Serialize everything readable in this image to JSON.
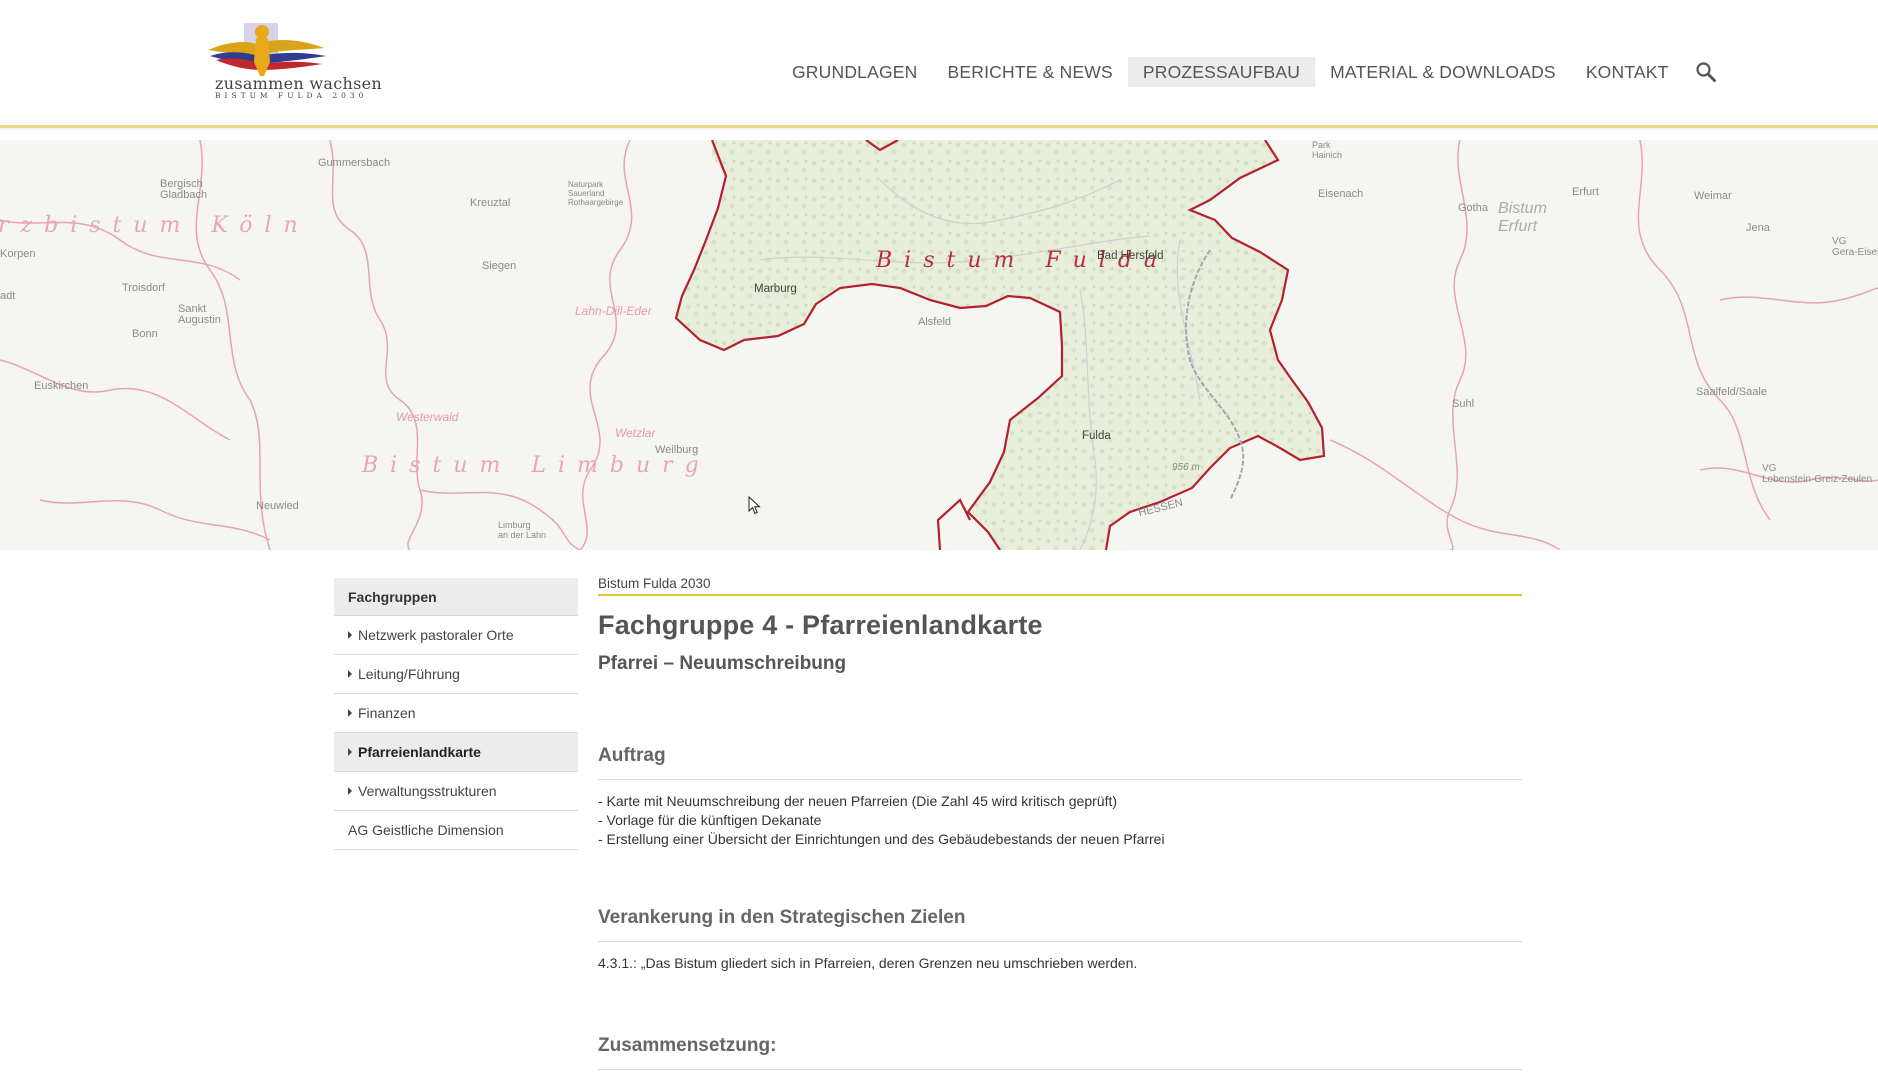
{
  "logo": {
    "text": "zusammen wachsen",
    "subtext": "BISTUM FULDA 2030"
  },
  "nav": {
    "items": [
      "GRUNDLAGEN",
      "BERICHTE & NEWS",
      "PROZESSAUFBAU",
      "MATERIAL & DOWNLOADS",
      "KONTAKT"
    ],
    "active": "PROZESSAUFBAU",
    "search_icon": "search-icon"
  },
  "map": {
    "dioceses": [
      "Bistum Köln",
      "Bistum Fulda",
      "Bistum Limburg",
      "Bistum Erfurt"
    ],
    "labels": {
      "bistum_koln": "rzbistum Köln",
      "bistum_fulda": "Bistum Fulda",
      "bistum_limburg": "Bistum Limburg",
      "bistum_erfurt": "Bistum\nErfurt",
      "marburg": "Marburg",
      "bad_hersfeld": "Bad Hersfeld",
      "fulda": "Fulda",
      "alsfeld": "Alsfeld",
      "gummersbach": "Gummersbach",
      "bergisch_gladbach": "Bergisch\nGladbach",
      "kreuztal": "Kreuztal",
      "siegen": "Siegen",
      "naturpark": "Naturpark\nSauerland\nRothaargebirge",
      "lahn_dill": "Lahn-Dill-Eder",
      "troisdorf": "Troisdorf",
      "sankt_augustin": "Sankt\nAugustin",
      "bonn": "Bonn",
      "euskirchen": "Euskirchen",
      "westerwald": "Westerwald",
      "wetzlar": "Wetzlar",
      "weilburg": "Weilburg",
      "neuwied": "Neuwied",
      "limburg_lahn": "Limburg\nan der Lahn",
      "eisenach": "Eisenach",
      "gotha": "Gotha",
      "erfurt": "Erfurt",
      "weimar": "Weimar",
      "jena": "Jena",
      "vg_gera": "VG\nGera-Eisenb",
      "suhl": "Suhl",
      "saalfeld": "Saalfeld/Saale",
      "vg_lobenstein": "VG\nLobenstein-Greiz-Zeulen",
      "hessen": "HESSEN",
      "elevation": "956 m",
      "korpen": "Korpen",
      "bad_hersfeld_park": "Park\nHainich",
      "duren": "adt"
    }
  },
  "sidebar": {
    "heading": "Fachgruppen",
    "items": [
      {
        "label": "Netzwerk pastoraler Orte",
        "bullet": true,
        "active": false
      },
      {
        "label": "Leitung/Führung",
        "bullet": true,
        "active": false
      },
      {
        "label": "Finanzen",
        "bullet": true,
        "active": false
      },
      {
        "label": "Pfarreienlandkarte",
        "bullet": true,
        "active": true
      },
      {
        "label": "Verwaltungsstrukturen",
        "bullet": true,
        "active": false
      },
      {
        "label": "AG Geistliche Dimension",
        "bullet": false,
        "active": false
      }
    ]
  },
  "main": {
    "breadcrumb": "Bistum Fulda 2030",
    "title": "Fachgruppe 4 - Pfarreienlandkarte",
    "subtitle": "Pfarrei – Neuumschreibung",
    "sections": [
      {
        "title": "Auftrag",
        "lines": [
          "- Karte mit Neuumschreibung der neuen Pfarreien (Die Zahl 45 wird kritisch geprüft)",
          "- Vorlage für die künftigen Dekanate",
          "- Erstellung einer Übersicht der Einrichtungen und des Gebäudebestands der neuen Pfarrei"
        ]
      },
      {
        "title": "Verankerung in den Strategischen Zielen",
        "lines": [
          "4.3.1.: „Das Bistum gliedert sich in Pfarreien, deren Grenzen neu umschrieben werden."
        ]
      },
      {
        "title": "Zusammensetzung:",
        "lines": []
      }
    ]
  }
}
